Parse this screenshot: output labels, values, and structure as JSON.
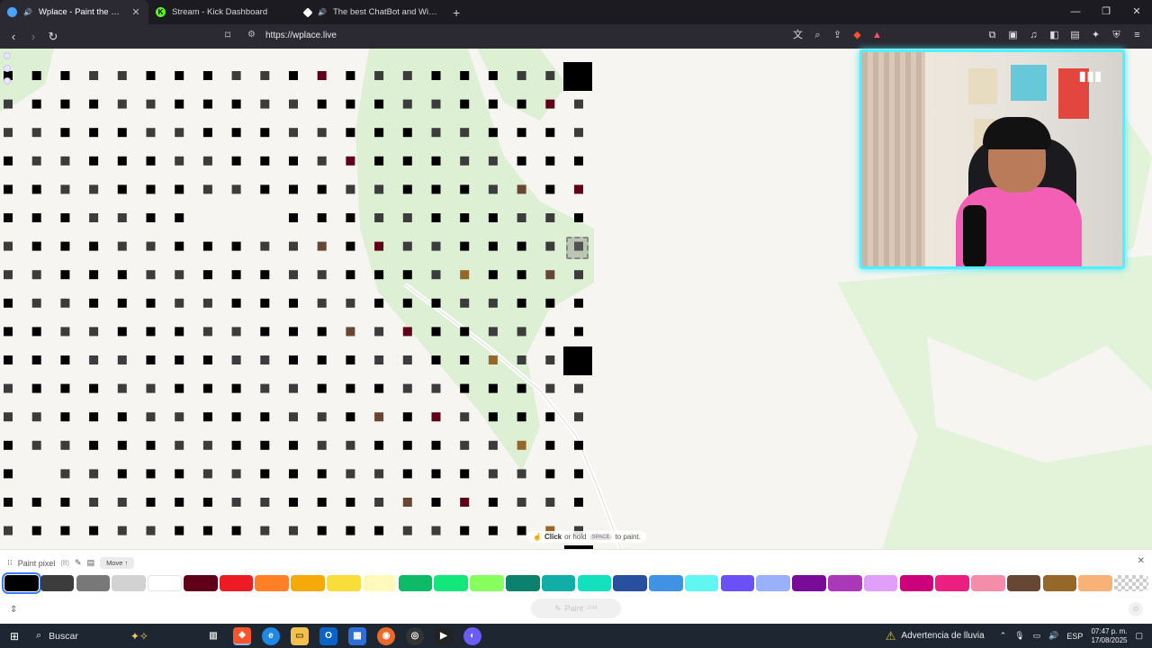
{
  "browser": {
    "tabs": [
      {
        "title": "Wplace - Paint the world",
        "active": true,
        "audio": true,
        "favicon_color": "#4aa3ff"
      },
      {
        "title": "Stream - Kick Dashboard",
        "active": false,
        "audio": false,
        "favicon_color": "#53fc18",
        "favicon_letter": "K"
      },
      {
        "title": "The best ChatBot and Widgets fo",
        "active": false,
        "audio": true,
        "favicon_color": "#ffffff"
      }
    ],
    "new_tab": "+",
    "window_controls": [
      "—",
      "❐",
      "✕"
    ],
    "url": "https://wplace.live"
  },
  "canvas": {
    "hint": {
      "bold": "Click",
      "rest": "or hold",
      "key": "SPACE",
      "end": "to paint."
    }
  },
  "paint_panel": {
    "title": "Paint pixel",
    "count": "(8)",
    "move_label": "Move ↑",
    "paint_button": "Paint",
    "paint_button_sub": "2/48 ",
    "palette": [
      "#000000",
      "#3c3c3c",
      "#787878",
      "#d2d2d2",
      "#ffffff",
      "#600018",
      "#ed1c24",
      "#ff7f27",
      "#f6aa09",
      "#f9dd3b",
      "#fffabc",
      "#0eb968",
      "#13e67b",
      "#87ff5e",
      "#0c816e",
      "#10aea6",
      "#13e1be",
      "#28509e",
      "#4093e4",
      "#60f7f2",
      "#6b50f6",
      "#99b1fb",
      "#780c99",
      "#aa38b9",
      "#e09ff9",
      "#cb007a",
      "#ec1f80",
      "#f38da9",
      "#684634",
      "#95682a",
      "#f8b277",
      "transparent"
    ],
    "selected_index": 0
  },
  "taskbar": {
    "search_label": "Buscar",
    "weather": "Advertencia de lluvia",
    "language": "ESP",
    "time": "07:47 p. m.",
    "date": "17/08/2025"
  }
}
